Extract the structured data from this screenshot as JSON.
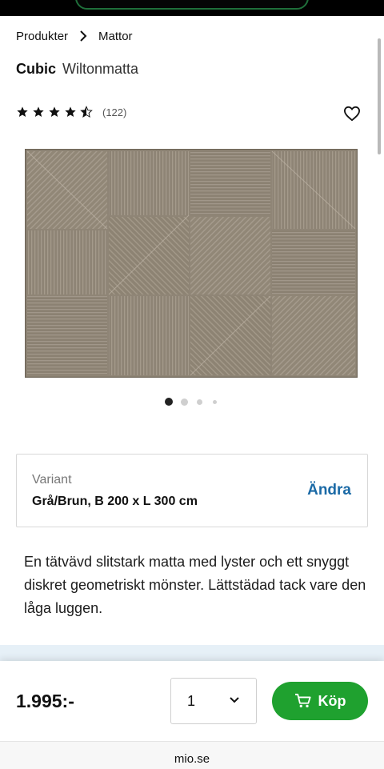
{
  "breadcrumb": {
    "items": [
      "Produkter",
      "Mattor"
    ],
    "separator_icon": "chevron-right-icon"
  },
  "product": {
    "name": "Cubic",
    "type": "Wiltonmatta",
    "rating": {
      "value": 4.5,
      "max": 5,
      "count_text": "(122)"
    },
    "image_alt": "gray-brown geometric rug",
    "gallery": {
      "images": 4,
      "active_index": 0
    }
  },
  "variant": {
    "label": "Variant",
    "value": "Grå/Brun, B 200 x L 300 cm",
    "change_label": "Ändra"
  },
  "description": "En tätvävd slitstark matta med lyster och ett snyggt diskret geometriskt mönster. Lättstädad tack vare den låga luggen.",
  "purchase": {
    "price": "1.995:-",
    "quantity": "1",
    "buy_label": "Köp",
    "buy_icon": "cart-icon"
  },
  "browser": {
    "url": "mio.se"
  },
  "colors": {
    "buy_button": "#1fa12f",
    "link": "#1b6aa6",
    "rug": "#8f8576"
  }
}
